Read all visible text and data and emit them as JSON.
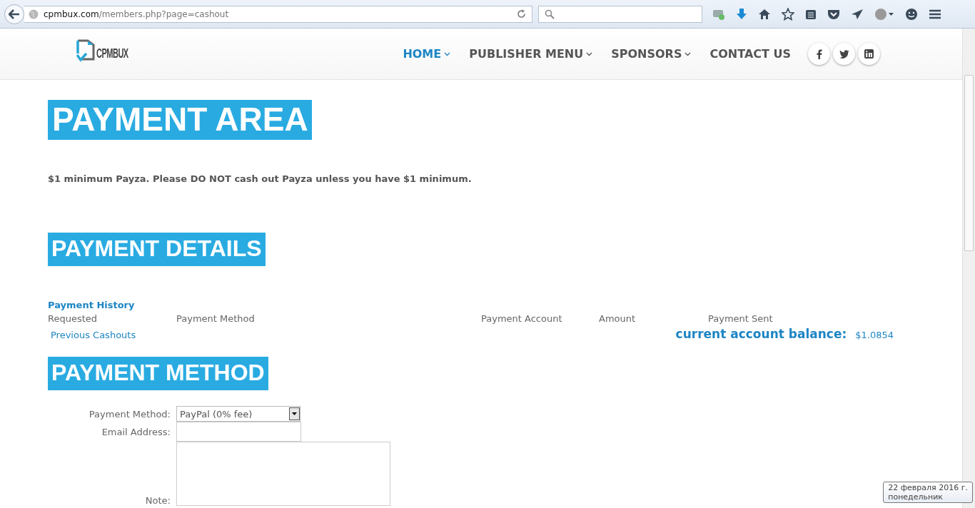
{
  "browser": {
    "url_host": "cpmbux.com",
    "url_path": "/members.php?page=cashout"
  },
  "site": {
    "logo_text": "CPMBUX",
    "nav": [
      {
        "label": "HOME",
        "selected": true,
        "has_menu": true
      },
      {
        "label": "PUBLISHER MENU",
        "selected": false,
        "has_menu": true
      },
      {
        "label": "SPONSORS",
        "selected": false,
        "has_menu": true
      },
      {
        "label": "CONTACT US",
        "selected": false,
        "has_menu": false
      }
    ]
  },
  "payment_area": {
    "title": "PAYMENT AREA",
    "notice": "$1 minimum Payza. Please DO NOT cash out Payza unless you have $1 minimum."
  },
  "payment_details": {
    "title": "PAYMENT DETAILS",
    "history_link": "Payment History",
    "columns": [
      "Requested",
      "Payment Method",
      "Payment Account",
      "Amount",
      "Payment Sent"
    ],
    "previous_link": "Previous Cashouts",
    "balance_label": "current account balance:",
    "balance": "$1.0854"
  },
  "payment_method": {
    "title": "PAYMENT METHOD",
    "method_label": "Payment Method:",
    "method_value": "PayPal (0% fee)",
    "email_label": "Email Address:",
    "note_label": "Note:"
  },
  "tooltip": {
    "lines": [
      "22 февраля 2016 г.",
      "понедельник"
    ]
  }
}
